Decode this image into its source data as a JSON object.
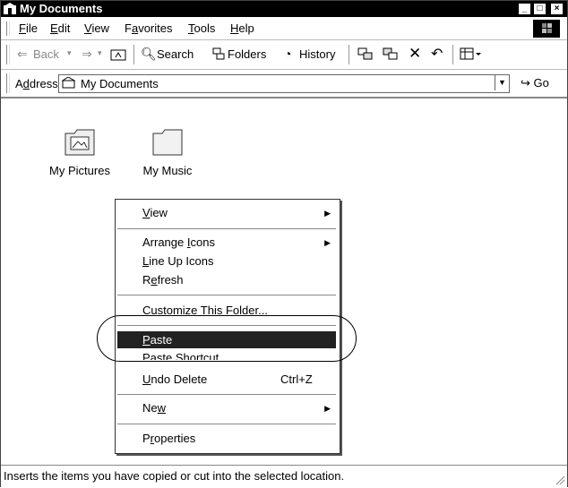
{
  "window": {
    "title": "My Documents",
    "controls": {
      "minimize": "_",
      "maximize": "□",
      "close": "×"
    }
  },
  "menubar": {
    "items": [
      {
        "label": "File",
        "accel": "F",
        "rest": "ile"
      },
      {
        "label": "Edit",
        "accel": "E",
        "rest": "dit"
      },
      {
        "label": "View",
        "accel": "V",
        "rest": "iew"
      },
      {
        "label": "Favorites",
        "pre": "F",
        "accel": "a",
        "rest": "vorites"
      },
      {
        "label": "Tools",
        "accel": "T",
        "rest": "ools"
      },
      {
        "label": "Help",
        "accel": "H",
        "rest": "elp"
      }
    ]
  },
  "toolbar": {
    "back": "Back",
    "search": "Search",
    "folders": "Folders",
    "history": "History"
  },
  "addressbar": {
    "label_pre": "A",
    "label_accel": "d",
    "label_rest": "dress",
    "value": "My Documents",
    "go": "Go"
  },
  "folders": [
    {
      "label": "My Pictures"
    },
    {
      "label": "My Music"
    }
  ],
  "context_menu": {
    "view": {
      "accel": "V",
      "rest": "iew"
    },
    "arrange_icons": {
      "pre": "Arrange ",
      "accel": "I",
      "rest": "cons"
    },
    "line_up_icons": {
      "accel": "L",
      "rest": "ine Up Icons"
    },
    "refresh": {
      "pre": "R",
      "accel": "e",
      "rest": "fresh"
    },
    "customize": "Customize This Folder...",
    "paste": {
      "accel": "P",
      "rest": "aste"
    },
    "paste_shortcut": {
      "pre": "Paste ",
      "accel": "S",
      "rest": "hortcut"
    },
    "undo_delete": {
      "accel": "U",
      "rest": "ndo Delete",
      "shortcut": "Ctrl+Z"
    },
    "new": {
      "pre": "Ne",
      "accel": "w",
      "rest": ""
    },
    "properties": {
      "pre": "P",
      "accel": "r",
      "rest": "operties"
    }
  },
  "statusbar": {
    "text": "Inserts the items you have copied or cut into the selected location."
  },
  "colors": {
    "highlight": "#222222",
    "titlebar": "#000000"
  }
}
